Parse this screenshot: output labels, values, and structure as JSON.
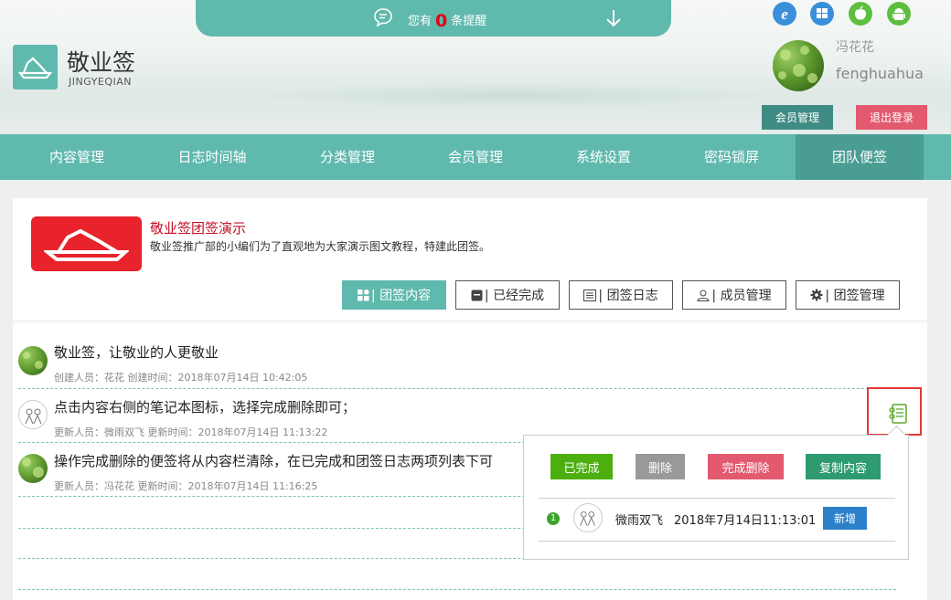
{
  "notice": {
    "prefix": "您有",
    "count": "0",
    "suffix": "条提醒"
  },
  "brand": {
    "name": "敬业签",
    "pinyin": "JINGYEQIAN"
  },
  "os_icons": [
    "ie-icon",
    "windows-icon",
    "apple-icon",
    "android-icon"
  ],
  "user": {
    "name_cn": "冯花花",
    "name_en": "fenghuahua"
  },
  "header_buttons": {
    "member": "会员管理",
    "logout": "退出登录"
  },
  "nav": [
    "内容管理",
    "日志时间轴",
    "分类管理",
    "会员管理",
    "系统设置",
    "密码锁屏",
    "团队便签"
  ],
  "nav_active": "团队便签",
  "team": {
    "title": "敬业签团签演示",
    "desc": "敬业签推广部的小编们为了直观地为大家演示图文教程，特建此团签。"
  },
  "tabs": [
    "| 团签内容",
    "| 已经完成",
    "| 团签日志",
    "| 成员管理",
    "| 团签管理"
  ],
  "items": [
    {
      "text": "敬业签，让敬业的人更敬业",
      "meta": "创建人员：花花 创建时间：2018年07月14日 10:42:05"
    },
    {
      "text": "点击内容右侧的笔记本图标，选择完成删除即可；",
      "meta": "更新人员：微雨双飞 更新时间：2018年07月14日 11:13:22"
    },
    {
      "text": "操作完成删除的便签将从内容栏清除，在已完成和团签日志两项列表下可",
      "meta": "更新人员：冯花花 更新时间：2018年07月14日 11:16:25"
    }
  ],
  "popup": {
    "buttons": [
      "已完成",
      "删除",
      "完成删除",
      "复制内容"
    ],
    "log": {
      "index": "1",
      "user": "微雨双飞",
      "time": "2018年7月14日11:13:01",
      "action": "新增"
    }
  },
  "colors": {
    "teal": "#5fb9ad",
    "teal_dark": "#4a9d93",
    "red": "#e8232b",
    "green": "#4caf0f",
    "gray": "#999999",
    "pink": "#e35a6f",
    "dark_green": "#2e9a70",
    "blue": "#2b80c9"
  }
}
